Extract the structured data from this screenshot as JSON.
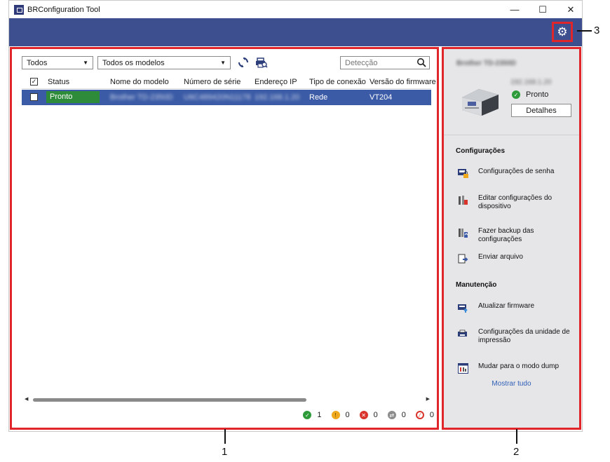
{
  "window": {
    "title": "BRConfiguration Tool",
    "controls": {
      "minimize": "—",
      "maximize": "☐",
      "close": "✕"
    }
  },
  "toolbar": {
    "filter_all": "Todos",
    "filter_models": "Todos os modelos",
    "search_placeholder": "Detecção"
  },
  "table": {
    "columns": [
      "Status",
      "Nome do modelo",
      "Número de série",
      "Endereço IP",
      "Tipo de conexão",
      "Versão do firmware"
    ],
    "rows": [
      {
        "checked": true,
        "status": "Pronto",
        "model": "Brother TD-2350D",
        "serial": "U6C489420N11178",
        "ip": "192.168.1.20",
        "connection": "Rede",
        "firmware": "VT204"
      }
    ]
  },
  "status_counts": [
    {
      "type": "ok",
      "icon": "check-circle-icon",
      "color": "#2e9b3a",
      "value": "1"
    },
    {
      "type": "warning",
      "icon": "warning-circle-icon",
      "color": "#f0a81c",
      "value": "0"
    },
    {
      "type": "error",
      "icon": "error-circle-icon",
      "color": "#d9342b",
      "value": "0"
    },
    {
      "type": "offline",
      "icon": "offline-circle-icon",
      "color": "#8c8c8c",
      "value": "0"
    },
    {
      "type": "disabled",
      "icon": "blocked-circle-icon",
      "color": "#d9342b",
      "value": "0"
    }
  ],
  "device": {
    "name": "Brother TD-2350D",
    "ip": "192.168.1.20",
    "status": "Pronto",
    "details_label": "Detalhes"
  },
  "settings_panel": {
    "settings_title": "Configurações",
    "settings_items": [
      {
        "label": "Configurações de senha",
        "icon": "password-settings-icon"
      },
      {
        "label": "Editar configurações do dispositivo",
        "icon": "edit-device-settings-icon"
      },
      {
        "label": "Fazer backup das configurações",
        "icon": "backup-settings-icon"
      },
      {
        "label": "Enviar arquivo",
        "icon": "send-file-icon"
      }
    ],
    "maintenance_title": "Manutenção",
    "maintenance_items": [
      {
        "label": "Atualizar firmware",
        "icon": "update-firmware-icon"
      },
      {
        "label": "Configurações da unidade de impressão",
        "icon": "print-unit-settings-icon"
      },
      {
        "label": "Mudar para o modo dump",
        "icon": "dump-mode-icon"
      }
    ],
    "show_all": "Mostrar tudo"
  },
  "callouts": [
    "1",
    "2",
    "3"
  ],
  "colors": {
    "header_band": "#3d4f8e",
    "selected_row": "#3b5ba6",
    "status_ready": "#2e8b3a",
    "highlight": "#e0262a"
  }
}
